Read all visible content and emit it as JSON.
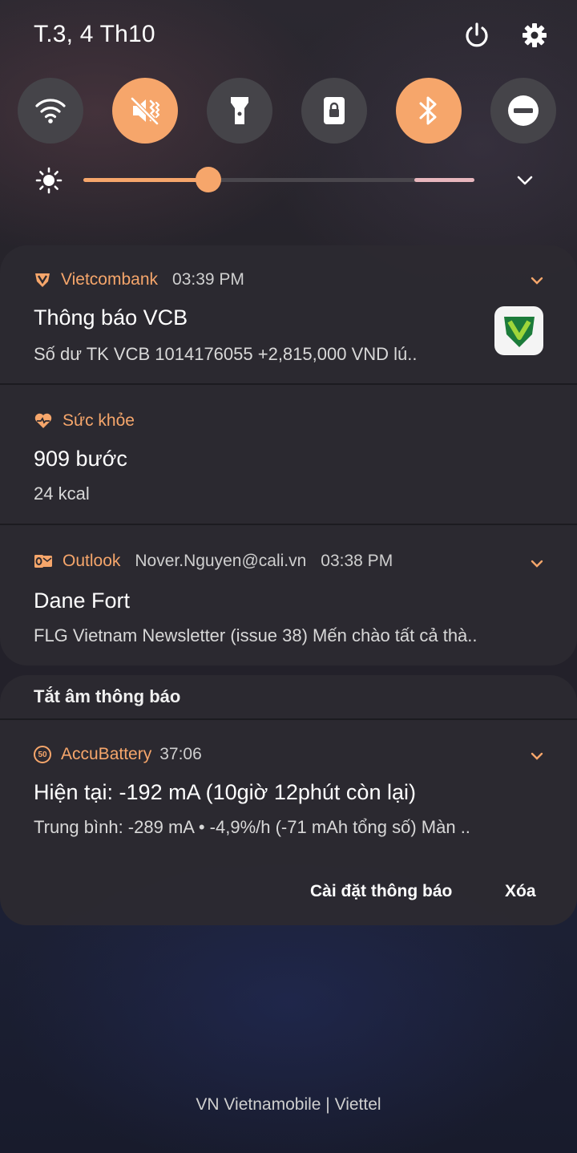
{
  "status": {
    "date": "T.3, 4 Th10"
  },
  "icons": {
    "power": "power-icon",
    "settings": "gear-icon",
    "wifi": "wifi-icon",
    "sound": "vibrate-icon",
    "flashlight": "flashlight-icon",
    "rotation_lock": "rotation-lock-icon",
    "bluetooth": "bluetooth-icon",
    "dnd": "do-not-disturb-icon",
    "expand": "chevron-down-icon"
  },
  "quick_tiles": [
    {
      "name": "wifi",
      "active": false
    },
    {
      "name": "sound",
      "active": true
    },
    {
      "name": "flashlight",
      "active": false
    },
    {
      "name": "rotation_lock",
      "active": false
    },
    {
      "name": "bluetooth",
      "active": true
    },
    {
      "name": "dnd",
      "active": false
    }
  ],
  "brightness": {
    "level": 0.32
  },
  "notifications": [
    {
      "app": "Vietcombank",
      "time": "03:39 PM",
      "title": "Thông báo VCB",
      "text": "Số dư TK VCB 1014176055 +2,815,000 VND lú.."
    },
    {
      "app": "Sức khỏe",
      "title": "909 bước",
      "text": "24 kcal"
    },
    {
      "app": "Outlook",
      "account": "Nover.Nguyen@cali.vn",
      "time": "03:38 PM",
      "title": "Dane Fort",
      "text": "FLG Vietnam Newsletter (issue 38) Mến chào tất cả thà.."
    }
  ],
  "silent_section": {
    "label": "Tắt âm thông báo",
    "notification": {
      "app": "AccuBattery",
      "badge": "50",
      "time": "37:06",
      "title": "Hiện tại: -192 mA (10giờ 12phút còn lại)",
      "text": "Trung bình: -289 mA • -4,9%/h (-71 mAh tổng số) Màn .."
    }
  },
  "actions": {
    "settings": "Cài đặt thông báo",
    "clear": "Xóa"
  },
  "carrier": "VN Vietnamobile | Viettel",
  "colors": {
    "accent": "#f6a66b",
    "tile_off": "#454449",
    "card": "#2c2a30"
  }
}
